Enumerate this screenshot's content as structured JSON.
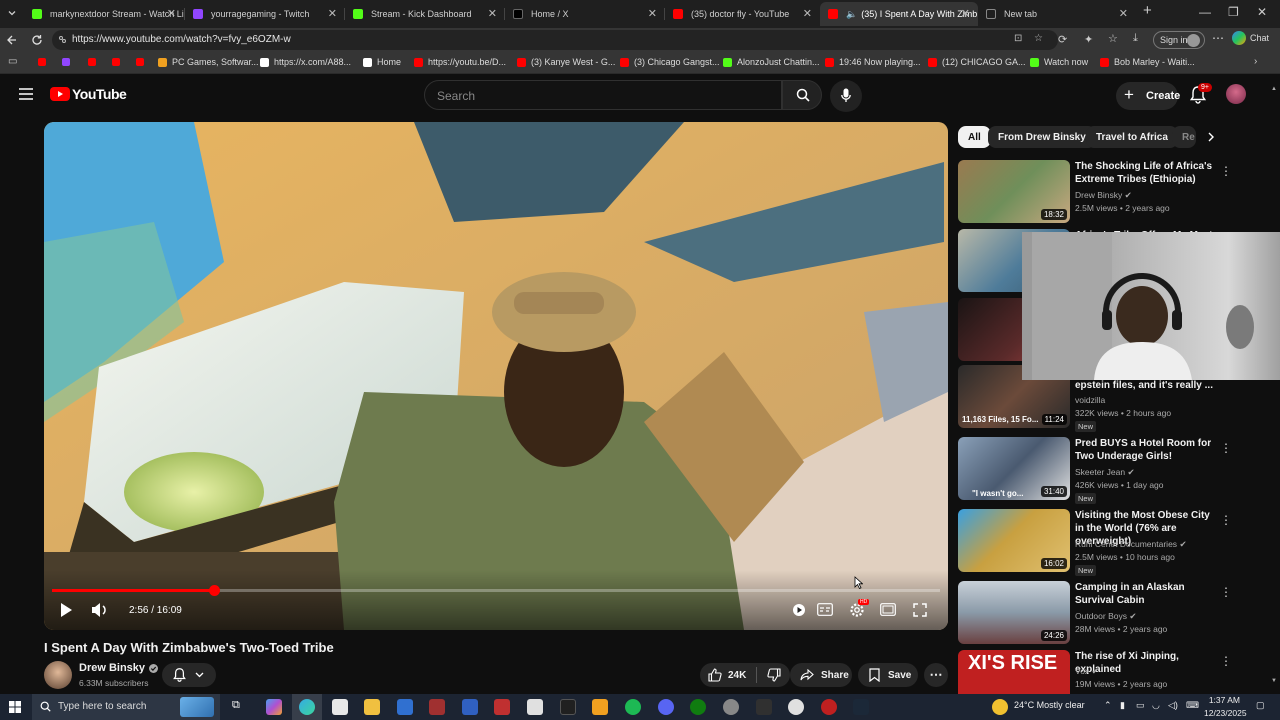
{
  "browser": {
    "tabs": [
      {
        "label": "markynextdoor Stream - Watch Li",
        "favicon_color": "#53fc18"
      },
      {
        "label": "yourragegaming - Twitch",
        "favicon_color": "#9146ff"
      },
      {
        "label": "Stream - Kick Dashboard",
        "favicon_color": "#53fc18"
      },
      {
        "label": "Home / X",
        "favicon_color": "#000000"
      },
      {
        "label": "(35) doctor fly - YouTube",
        "favicon_color": "#ff0000"
      },
      {
        "label": "(35) I Spent A Day With Zimb",
        "favicon_color": "#ff0000"
      },
      {
        "label": "New tab",
        "favicon_color": "#888888"
      }
    ],
    "url": "https://www.youtube.com/watch?v=fvy_e6OZM-w",
    "signin_label": "Sign in",
    "chat_label": "Chat",
    "bookmarks": [
      {
        "label": "PC Games, Softwar...",
        "color": "#f0a020"
      },
      {
        "label": "https://x.com/A88...",
        "color": "#ffffff"
      },
      {
        "label": "Home",
        "color": "#ffffff"
      },
      {
        "label": "https://youtu.be/D...",
        "color": "#ff0000"
      },
      {
        "label": "(3) Kanye West - G...",
        "color": "#ff0000"
      },
      {
        "label": "(3) Chicago Gangst...",
        "color": "#ff0000"
      },
      {
        "label": "AlonzoJust Chattin...",
        "color": "#53fc18"
      },
      {
        "label": "19:46 Now playing...",
        "color": "#ff0000"
      },
      {
        "label": "(12) CHICAGO GA...",
        "color": "#ff0000"
      },
      {
        "label": "Watch now",
        "color": "#53fc18"
      },
      {
        "label": "Bob Marley - Waiti...",
        "color": "#ff0000"
      }
    ]
  },
  "youtube": {
    "logo_text": "YouTube",
    "search_placeholder": "Search",
    "create_label": "Create",
    "notif_count": "9+",
    "player": {
      "time": "2:56 / 16:09",
      "progress_fraction": 0.182
    },
    "video_title": "I Spent A Day With Zimbabwe's Two-Toed Tribe",
    "channel": {
      "name": "Drew Binsky",
      "subscribers": "6.33M subscribers"
    },
    "actions": {
      "likes": "24K",
      "share": "Share",
      "save": "Save"
    },
    "chips": [
      "All",
      "From Drew Binsky",
      "Travel to Africa",
      "Re"
    ],
    "recommendations": [
      {
        "title": "The Shocking Life of Africa's Extreme Tribes (Ethiopia)",
        "channel": "Drew Binsky",
        "verified": true,
        "views": "2.5M views",
        "age": "2 years ago",
        "duration": "18:32",
        "is_new": false,
        "thumb_color": "#6f8f5a"
      },
      {
        "title": "Africa's Tribe Offers Me Meat",
        "channel": "",
        "verified": false,
        "views": "",
        "age": "",
        "duration": "",
        "is_new": false,
        "thumb_color": "#4f7c9a"
      },
      {
        "title": "",
        "channel": "",
        "verified": false,
        "views": "",
        "age": "",
        "duration": "",
        "is_new": false,
        "thumb_color": "#3a2424"
      },
      {
        "title": "epstein files, and it's really ...",
        "channel": "voidzilla",
        "verified": false,
        "views": "322K views",
        "age": "2 hours ago",
        "duration": "11:24",
        "is_new": true,
        "thumb_color": "#2a2a2a",
        "thumb_text": "11,163 Files, 15 Fo..."
      },
      {
        "title": "Pred BUYS a Hotel Room for Two Underage Girls!",
        "channel": "Skeeter Jean",
        "verified": true,
        "views": "426K views",
        "age": "1 day ago",
        "duration": "31:40",
        "is_new": true,
        "thumb_color": "#4a5a70",
        "thumb_text": "\"I wasn't go..."
      },
      {
        "title": "Visiting the Most Obese City in the World (76% are overweight)",
        "channel": "Ruhi Cenet Documentaries",
        "verified": true,
        "views": "2.5M views",
        "age": "10 hours ago",
        "duration": "16:02",
        "is_new": true,
        "thumb_color": "#c8a040"
      },
      {
        "title": "Camping in an Alaskan Survival Cabin",
        "channel": "Outdoor Boys",
        "verified": true,
        "views": "28M views",
        "age": "2 years ago",
        "duration": "24:26",
        "is_new": false,
        "thumb_color": "#8a9aa8"
      },
      {
        "title": "The rise of Xi Jinping, explained",
        "channel": "Vox",
        "verified": true,
        "views": "19M views",
        "age": "2 years ago",
        "duration": "",
        "is_new": false,
        "thumb_color": "#c02020",
        "thumb_text": "XI'S RISE"
      },
      {
        "title": "",
        "channel": "",
        "verified": false,
        "views": "",
        "age": "",
        "duration": "",
        "is_new": false
      }
    ]
  },
  "taskbar": {
    "search_placeholder": "Type here to search",
    "weather": "24°C  Mostly clear",
    "time": "1:37 AM",
    "date": "12/23/2025"
  },
  "colors": {
    "accent_red": "#ff0000",
    "kick_green": "#53fc18",
    "twitch_purple": "#9146ff",
    "yt_bg": "#0f0f0f"
  }
}
